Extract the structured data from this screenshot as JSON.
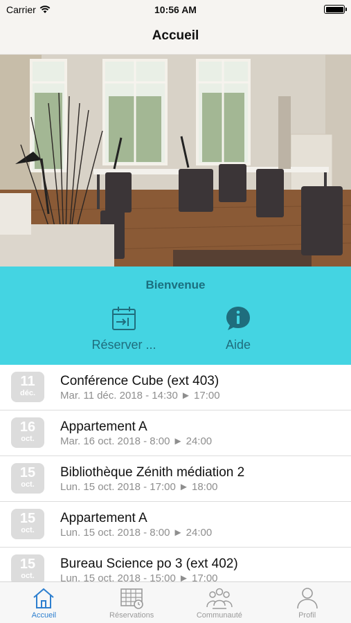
{
  "status_bar": {
    "carrier": "Carrier",
    "time": "10:56 AM"
  },
  "nav": {
    "title": "Accueil"
  },
  "welcome": {
    "title": "Bienvenue",
    "actions": [
      {
        "label": "Réserver ...",
        "icon": "calendar-enter-icon"
      },
      {
        "label": "Aide",
        "icon": "info-bubble-icon"
      }
    ]
  },
  "reservations": [
    {
      "day": "11",
      "month": "déc.",
      "title": "Conférence Cube (ext 403)",
      "detail": "Mar. 11 déc. 2018 - 14:30 ► 17:00"
    },
    {
      "day": "16",
      "month": "oct.",
      "title": "Appartement A",
      "detail": "Mar. 16 oct. 2018 - 8:00 ► 24:00"
    },
    {
      "day": "15",
      "month": "oct.",
      "title": "Bibliothèque Zénith médiation 2",
      "detail": "Lun. 15 oct. 2018 - 17:00 ► 18:00"
    },
    {
      "day": "15",
      "month": "oct.",
      "title": "Appartement A",
      "detail": "Lun. 15 oct. 2018 - 8:00 ► 24:00"
    },
    {
      "day": "15",
      "month": "oct.",
      "title": "Bureau Science po 3 (ext 402)",
      "detail": "Lun. 15 oct. 2018 - 15:00 ► 17:00"
    }
  ],
  "tabs": [
    {
      "label": "Accueil",
      "icon": "home-icon",
      "active": true
    },
    {
      "label": "Réservations",
      "icon": "calendar-grid-icon",
      "active": false
    },
    {
      "label": "Communauté",
      "icon": "community-icon",
      "active": false
    },
    {
      "label": "Profil",
      "icon": "person-icon",
      "active": false
    }
  ],
  "colors": {
    "welcome_background": "#44d4e2",
    "welcome_text": "#1f6d7d",
    "tab_active": "#2d7fcf",
    "tab_inactive": "#9a9a9a",
    "date_badge": "#dcdcdc"
  }
}
